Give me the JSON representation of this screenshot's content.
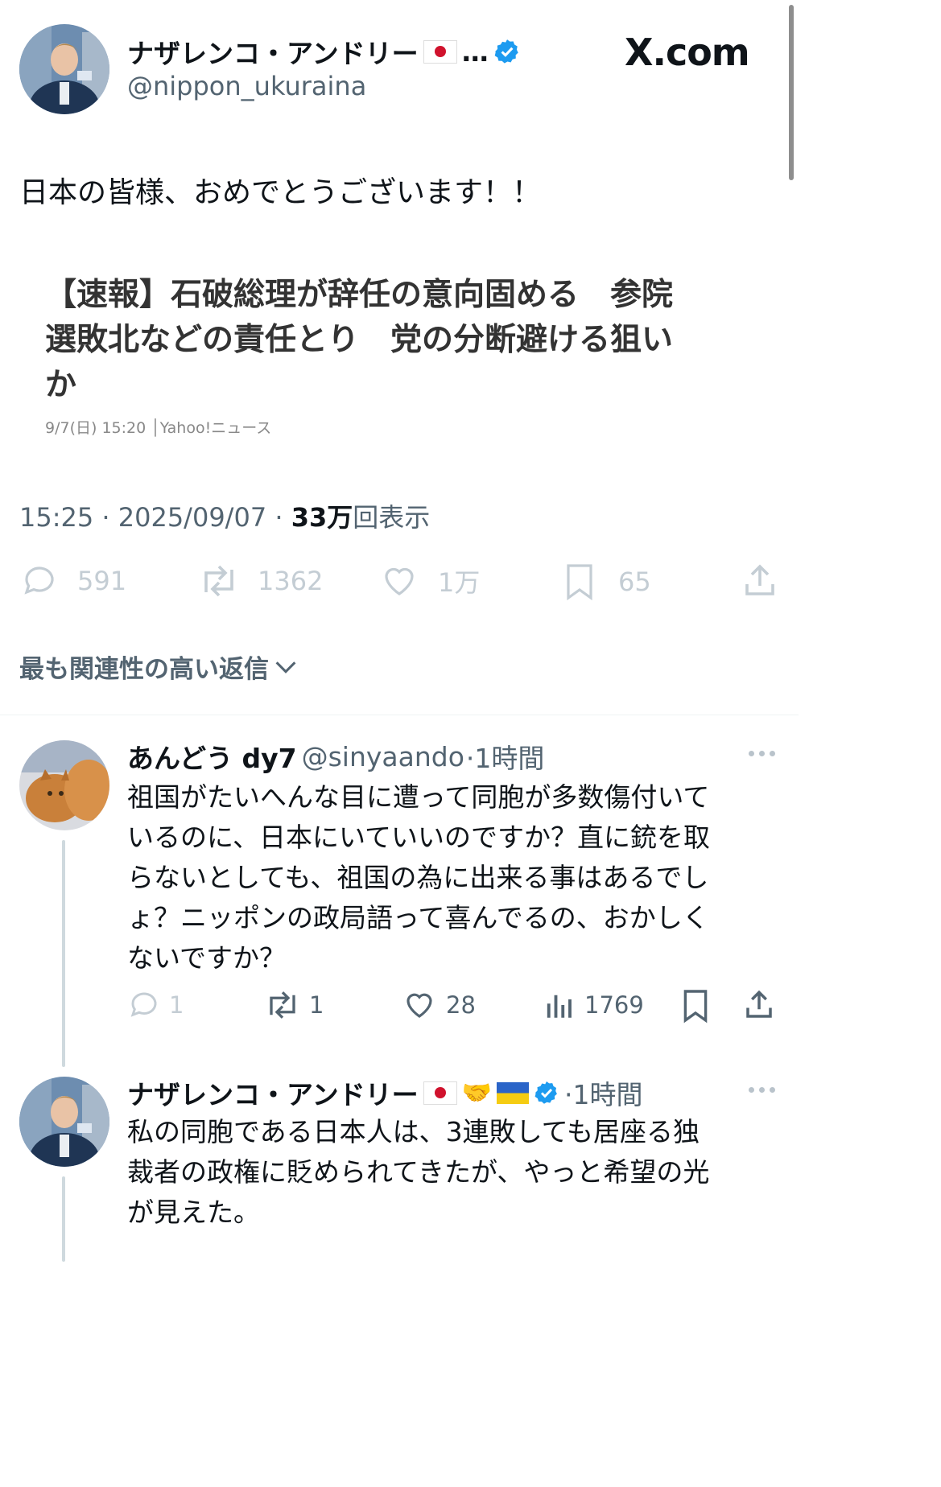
{
  "logo": {
    "text": "X.com"
  },
  "main_post": {
    "author_name": "ナザレンコ・アンドリー",
    "author_name_suffix": "…",
    "author_handle": "@nippon_ukuraina",
    "text": "日本の皆様、おめでとうございます！！",
    "quote_card": {
      "headline_line1": "【速報】石破総理が辞任の意向固める　参院",
      "headline_line2": "選敗北などの責任とり　党の分断避ける狙い",
      "headline_line3": "か",
      "meta": "9/7(日) 15:20 │Yahoo!ニュース"
    },
    "time": "15:25 · 2025/09/07 · ",
    "views_count": "33万",
    "views_label": "回表示",
    "stats": {
      "replies": "591",
      "reposts": "1362",
      "likes": "1万",
      "bookmarks": "65"
    }
  },
  "replies_sort": {
    "label": "最も関連性の高い返信"
  },
  "replies": [
    {
      "name": "あんどう dy7",
      "handle": "@sinyaando",
      "time": "·1時間",
      "lines": [
        "祖国がたいへんな目に遭って同胞が多数傷付いて",
        "いるのに、日本にいていいのですか？直に銃を取",
        "らないとしても、祖国の為に出来る事はあるでし",
        "ょ？ニッポンの政局語って喜んでるの、おかしく",
        "ないですか？"
      ],
      "stats": {
        "replies": "1",
        "reposts": "1",
        "likes": "28",
        "views": "1769"
      }
    },
    {
      "name": "ナザレンコ・アンドリー",
      "time": "·1時間",
      "lines": [
        "私の同胞である日本人は、3連敗しても居座る独",
        "裁者の政権に貶められてきたが、やっと希望の光",
        "が見えた。"
      ]
    }
  ],
  "colors": {
    "verified": "#1d9bf0",
    "muted": "#536471",
    "faint": "#c4cdd4"
  }
}
